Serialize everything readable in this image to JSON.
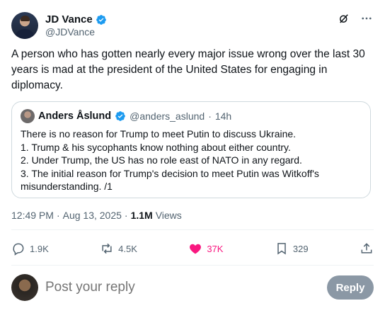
{
  "post": {
    "author": {
      "display_name": "JD Vance",
      "handle": "@JDVance",
      "verified": true
    },
    "text": "A person who has gotten nearly every major issue wrong over the last 30 years is mad at the president of the United States for engaging in diplomacy.",
    "header_icons": [
      "grok-icon",
      "more-icon"
    ]
  },
  "quote": {
    "author": {
      "display_name": "Anders Åslund",
      "handle": "@anders_aslund",
      "separator": "·",
      "time": "14h",
      "verified": true
    },
    "lines": [
      "There is no reason for Trump to meet Putin to discuss Ukraine.",
      "1. Trump & his sycophants know nothing about either country.",
      "2. Under Trump, the US has no role east of NATO in any regard.",
      "3. The initial reason for Trump's decision to meet Putin was Witkoff's",
      "misunderstanding. /1"
    ]
  },
  "meta": {
    "time": "12:49 PM",
    "separator": "·",
    "date": "Aug 13, 2025",
    "separator2": "·",
    "views_count": "1.1M",
    "views_label": "Views"
  },
  "actions": {
    "replies": "1.9K",
    "reposts": "4.5K",
    "likes": "37K",
    "bookmarks": "329"
  },
  "colors": {
    "verified": "#1d9bf0",
    "like": "#f91880",
    "muted": "#536471",
    "border": "#cfd9de",
    "reply_button": "#8b98a5"
  },
  "reply": {
    "placeholder": "Post your reply",
    "button_label": "Reply"
  }
}
